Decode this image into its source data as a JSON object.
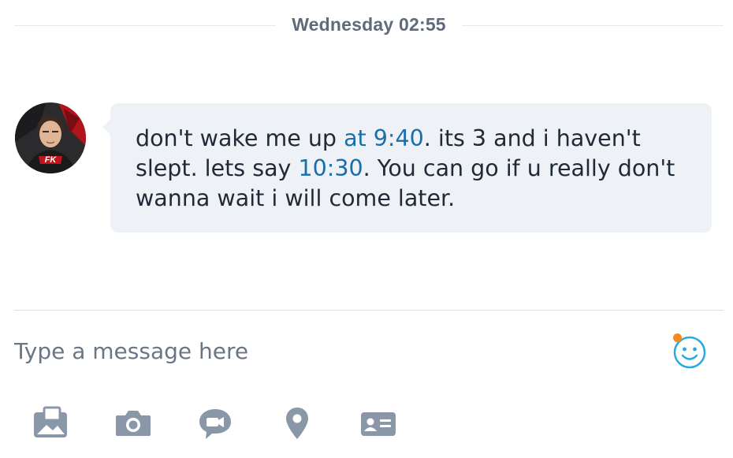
{
  "conversation": {
    "date_separator": "Wednesday 02:55"
  },
  "message": {
    "avatar_badge": "FK",
    "segments": [
      {
        "text": "don't wake me up ",
        "link": false
      },
      {
        "text": "at 9:40",
        "link": true
      },
      {
        "text": ". its 3 and i haven't slept. lets say ",
        "link": false
      },
      {
        "text": "10:30",
        "link": true
      },
      {
        "text": ". You can go if u really don't wanna wait i will come later.",
        "link": false
      }
    ]
  },
  "composer": {
    "placeholder": "Type a message here",
    "emoji_icon": "emoji-smiley-icon",
    "notification_color": "#f58a1f"
  },
  "toolbar": {
    "items": [
      {
        "icon": "gallery-icon"
      },
      {
        "icon": "camera-icon"
      },
      {
        "icon": "video-message-icon"
      },
      {
        "icon": "location-icon"
      },
      {
        "icon": "contact-card-icon"
      }
    ]
  },
  "colors": {
    "accent": "#29a9df",
    "link": "#1a6fa8",
    "bubble_bg": "#eef1f5",
    "icon_gray": "#8a97a8"
  }
}
